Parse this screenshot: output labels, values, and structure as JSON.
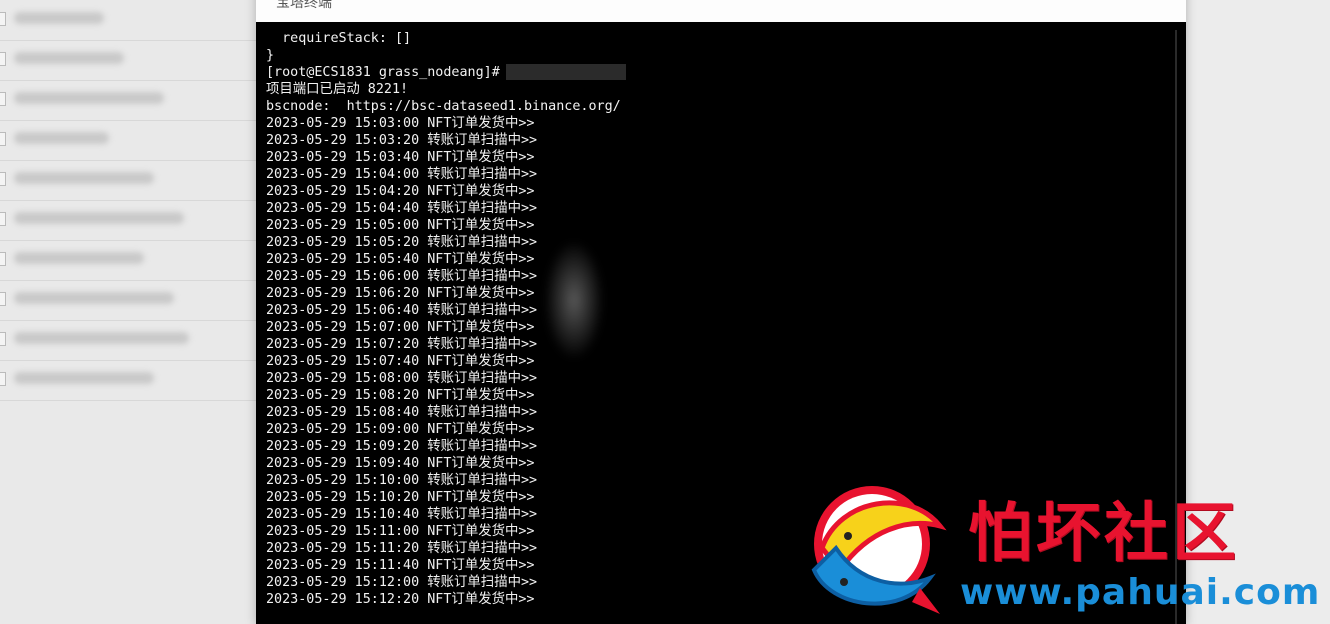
{
  "dialog": {
    "title": "宝塔终端"
  },
  "terminal": {
    "pre_lines": [
      "  requireStack: []",
      "}"
    ],
    "prompt": "[root@ECS1831 grass_nodeang]#",
    "post_lines": [
      "项目端口已启动 8221!",
      "bscnode:  https://bsc-dataseed1.binance.org/",
      "2023-05-29 15:03:00 NFT订单发货中>>",
      "2023-05-29 15:03:20 转账订单扫描中>>",
      "2023-05-29 15:03:40 NFT订单发货中>>",
      "2023-05-29 15:04:00 转账订单扫描中>>",
      "2023-05-29 15:04:20 NFT订单发货中>>",
      "2023-05-29 15:04:40 转账订单扫描中>>",
      "2023-05-29 15:05:00 NFT订单发货中>>",
      "2023-05-29 15:05:20 转账订单扫描中>>",
      "2023-05-29 15:05:40 NFT订单发货中>>",
      "2023-05-29 15:06:00 转账订单扫描中>>",
      "2023-05-29 15:06:20 NFT订单发货中>>",
      "2023-05-29 15:06:40 转账订单扫描中>>",
      "2023-05-29 15:07:00 NFT订单发货中>>",
      "2023-05-29 15:07:20 转账订单扫描中>>",
      "2023-05-29 15:07:40 NFT订单发货中>>",
      "2023-05-29 15:08:00 转账订单扫描中>>",
      "2023-05-29 15:08:20 NFT订单发货中>>",
      "2023-05-29 15:08:40 转账订单扫描中>>",
      "2023-05-29 15:09:00 NFT订单发货中>>",
      "2023-05-29 15:09:20 转账订单扫描中>>",
      "2023-05-29 15:09:40 NFT订单发货中>>",
      "2023-05-29 15:10:00 转账订单扫描中>>",
      "2023-05-29 15:10:20 NFT订单发货中>>",
      "2023-05-29 15:10:40 转账订单扫描中>>",
      "2023-05-29 15:11:00 NFT订单发货中>>",
      "2023-05-29 15:11:20 转账订单扫描中>>",
      "2023-05-29 15:11:40 NFT订单发货中>>",
      "2023-05-29 15:12:00 转账订单扫描中>>",
      "2023-05-29 15:12:20 NFT订单发货中>>"
    ]
  },
  "watermark": {
    "name": "怕坏社区",
    "url": "www.pahuai.com",
    "colors": {
      "red": "#e8132f",
      "blue": "#1a8ed8",
      "yellow": "#f7d21a"
    }
  },
  "colors": {
    "terminal_bg": "#000000",
    "terminal_fg": "#f2f2f2",
    "page_bg": "#e9e9e9"
  }
}
